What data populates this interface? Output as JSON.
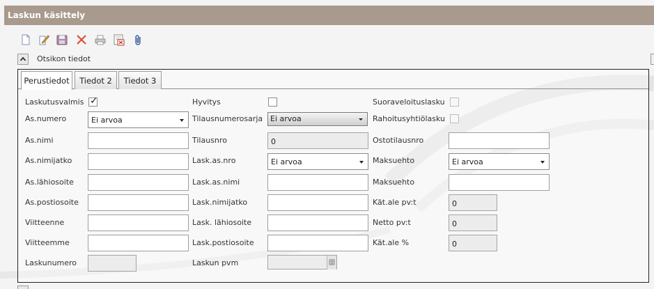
{
  "window": {
    "title": "Laskun käsittely"
  },
  "toolbar": {
    "icons": [
      "new-document-icon",
      "edit-icon",
      "save-icon",
      "delete-icon",
      "print-icon",
      "delete-row-icon",
      "attachment-icon"
    ]
  },
  "section": {
    "title": "Otsikon tiedot"
  },
  "tabs": [
    {
      "label": "Perustiedot",
      "active": true
    },
    {
      "label": "Tiedot 2",
      "active": false
    },
    {
      "label": "Tiedot 3",
      "active": false
    }
  ],
  "form": {
    "col1": {
      "laskutusvalmis": {
        "label": "Laskutusvalmis",
        "checked": true
      },
      "asnumero": {
        "label": "As.numero",
        "value": "Ei arvoa"
      },
      "asnimi": {
        "label": "As.nimi",
        "value": ""
      },
      "asnimijatko": {
        "label": "As.nimijatko",
        "value": ""
      },
      "aslahiosoite": {
        "label": "As.lähiosoite",
        "value": ""
      },
      "aspostiosoite": {
        "label": "As.postiosoite",
        "value": ""
      },
      "viitteenne": {
        "label": "Viitteenne",
        "value": ""
      },
      "viitteemme": {
        "label": "Viitteemme",
        "value": ""
      },
      "laskunumero": {
        "label": "Laskunumero",
        "value": ""
      }
    },
    "col2": {
      "hyvitys": {
        "label": "Hyvitys",
        "checked": false
      },
      "tilausnumerosarja": {
        "label": "Tilausnumerosarja",
        "value": "Ei arvoa"
      },
      "tilausnro": {
        "label": "Tilausnro",
        "value": "0"
      },
      "laskasnro": {
        "label": "Lask.as.nro",
        "value": "Ei arvoa"
      },
      "laskasnimi": {
        "label": "Lask.as.nimi",
        "value": ""
      },
      "lasknimijatko": {
        "label": "Lask.nimijatko",
        "value": ""
      },
      "lasklahiosoite": {
        "label": "Lask. lähiosoite",
        "value": ""
      },
      "laskpostiosoite": {
        "label": "Lask.postiosoite",
        "value": ""
      },
      "laskunpvm": {
        "label": "Laskun pvm",
        "value": ""
      }
    },
    "col3": {
      "suoraveloituslasku": {
        "label": "Suoraveloituslasku",
        "checked": false
      },
      "rahoitusyhtiolasku": {
        "label": "Rahoitusyhtiölasku",
        "checked": false
      },
      "ostotilausnro": {
        "label": "Ostotilausnro",
        "value": ""
      },
      "maksuehto": {
        "label": "Maksuehto",
        "value": "Ei arvoa"
      },
      "maksuehto2": {
        "label": "Maksuehto",
        "value": ""
      },
      "katale_pvt": {
        "label": "Kät.ale pv:t",
        "value": "0"
      },
      "netto_pvt": {
        "label": "Netto pv:t",
        "value": "0"
      },
      "katale_pct": {
        "label": "Kät.ale %",
        "value": "0"
      }
    }
  },
  "colors": {
    "titlebar": "#a89a8c",
    "panel_border": "#222222"
  }
}
